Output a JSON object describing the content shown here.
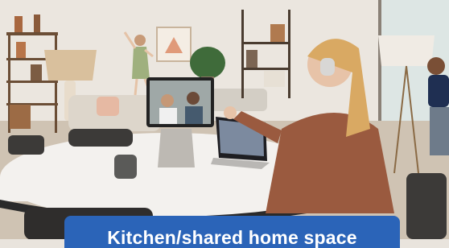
{
  "photo": {
    "subject": "living-room-video-call-scene"
  },
  "caption": {
    "text": "Kitchen/shared home space",
    "background_color": "#2b64b8",
    "text_color": "#ffffff"
  }
}
